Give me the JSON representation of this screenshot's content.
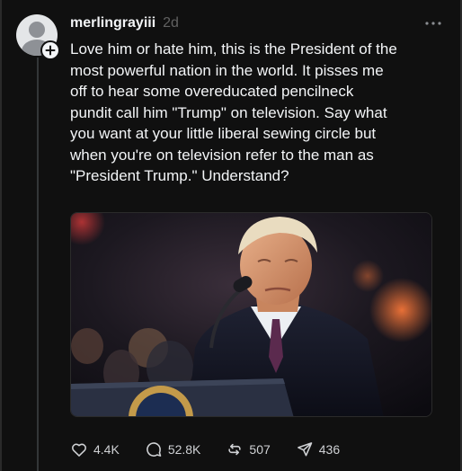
{
  "post": {
    "username": "merlingrayiii",
    "time_ago": "2d",
    "text": "Love him or hate him, this is the President of the\nmost powerful nation in the world. It pisses me\noff to hear some overeducated pencilneck\npundit call him \"Trump\" on television. Say what\nyou want at your little liberal sewing circle but\nwhen you're on television refer to the man as\n\"President Trump.\" Understand?",
    "image_icon": "photo-of-man-at-podium-microphone"
  },
  "actions": {
    "likes": "4.4K",
    "replies": "52.8K",
    "reposts": "507",
    "shares": "436"
  },
  "colors": {
    "background": "#101010",
    "text": "#f3f5f7",
    "muted": "#616161"
  }
}
